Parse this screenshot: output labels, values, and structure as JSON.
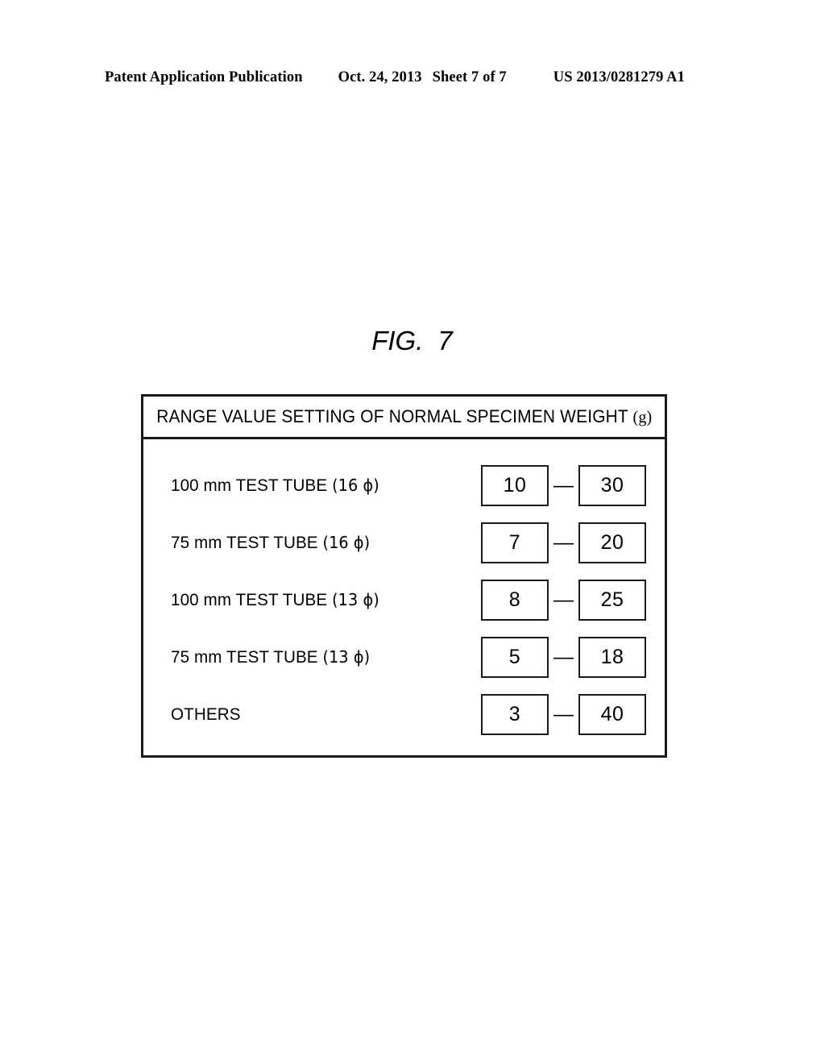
{
  "page_header": {
    "publication": "Patent Application Publication",
    "date": "Oct. 24, 2013",
    "sheet": "Sheet 7 of 7",
    "patent_number": "US 2013/0281279 A1"
  },
  "figure": {
    "label_word": "FIG.",
    "label_number": "7"
  },
  "table": {
    "title": "RANGE VALUE SETTING OF NORMAL SPECIMEN WEIGHT",
    "title_unit": "(g)",
    "range_separator": "—",
    "rows": [
      {
        "label_prefix": "100 mm TEST TUBE",
        "label_paren": "(16 ϕ)",
        "min": "10",
        "max": "30"
      },
      {
        "label_prefix": "75 mm TEST TUBE",
        "label_paren": "(16 ϕ)",
        "min": "7",
        "max": "20"
      },
      {
        "label_prefix": "100 mm TEST TUBE",
        "label_paren": "(13 ϕ)",
        "min": "8",
        "max": "25"
      },
      {
        "label_prefix": "75 mm TEST TUBE",
        "label_paren": "(13 ϕ)",
        "min": "5",
        "max": "18"
      },
      {
        "label_prefix": "OTHERS",
        "label_paren": "",
        "min": "3",
        "max": "40"
      }
    ]
  }
}
